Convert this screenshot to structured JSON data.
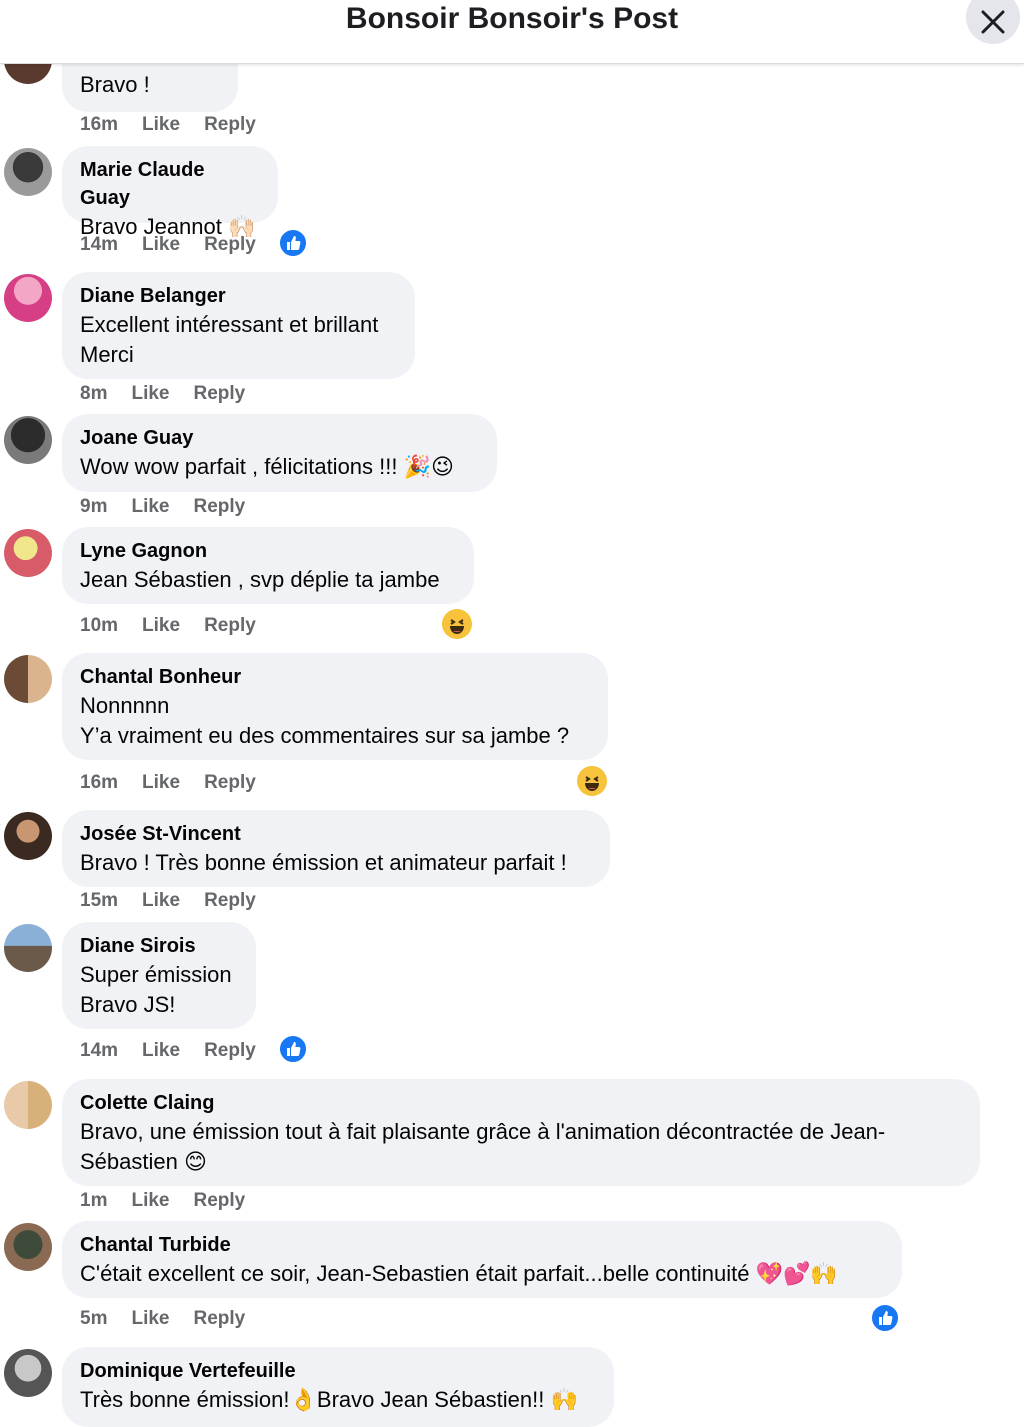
{
  "header": {
    "title": "Bonsoir Bonsoir's Post"
  },
  "comments": [
    {
      "author": "",
      "text": "Bravo !",
      "time": "16m",
      "like": "Like",
      "reply": "Reply"
    },
    {
      "author": "Marie Claude Guay",
      "text": "Bravo Jeannot 🙌🏻",
      "time": "14m",
      "like": "Like",
      "reply": "Reply",
      "reaction": "like-icon"
    },
    {
      "author": "Diane Belanger",
      "text": "Excellent intéressant et brillant\nMerci",
      "time": "8m",
      "like": "Like",
      "reply": "Reply"
    },
    {
      "author": "Joane Guay",
      "text": "Wow wow parfait , félicitations !!! 🎉😉",
      "time": "9m",
      "like": "Like",
      "reply": "Reply"
    },
    {
      "author": "Lyne Gagnon",
      "text": "Jean Sébastien , svp déplie ta jambe",
      "time": "10m",
      "like": "Like",
      "reply": "Reply",
      "reaction": "haha-icon"
    },
    {
      "author": "Chantal Bonheur",
      "text": "Nonnnnn\nY’a vraiment eu des commentaires sur sa jambe ?",
      "time": "16m",
      "like": "Like",
      "reply": "Reply",
      "reaction": "haha-icon"
    },
    {
      "author": "Josée St-Vincent",
      "text": "Bravo ! Très bonne émission et animateur parfait !",
      "time": "15m",
      "like": "Like",
      "reply": "Reply"
    },
    {
      "author": "Diane Sirois",
      "text": "Super émission\nBravo JS!",
      "time": "14m",
      "like": "Like",
      "reply": "Reply",
      "reaction": "like-icon"
    },
    {
      "author": "Colette Claing",
      "text": "Bravo, une émission tout à fait plaisante grâce à l'animation décontractée de Jean-\nSébastien 😊",
      "time": "1m",
      "like": "Like",
      "reply": "Reply"
    },
    {
      "author": "Chantal Turbide",
      "text": "C'était excellent ce soir, Jean-Sebastien était parfait...belle continuité 💖💕🙌",
      "time": "5m",
      "like": "Like",
      "reply": "Reply",
      "reaction": "like-icon"
    },
    {
      "author": "Dominique Vertefeuille",
      "text": "Très bonne émission!👌Bravo Jean Sébastien!! 🙌",
      "time": "",
      "like": "",
      "reply": ""
    }
  ],
  "colors": {
    "like_blue": "#1877f2",
    "bubble": "#f0f2f5",
    "meta": "#65676b"
  }
}
